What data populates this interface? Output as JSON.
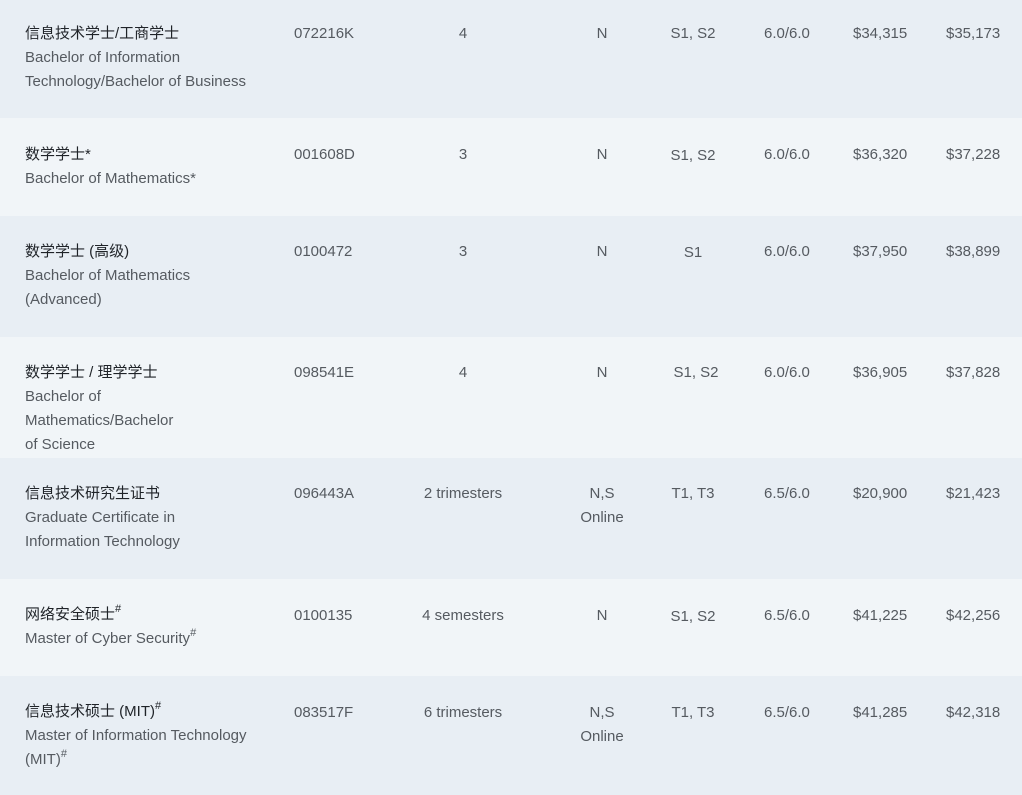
{
  "rows": [
    {
      "name_zh": "信息技术学士/工商学士",
      "name_en": "Bachelor of Information Technology/Bachelor of Business",
      "sup_zh": "",
      "sup_en": "",
      "code": "072216K",
      "duration": "4",
      "campus_line1": "N",
      "campus_line2": "",
      "intake": "S1, S2",
      "ielts": "6.0/6.0",
      "fee_a": "$34,315",
      "fee_b": "$35,173"
    },
    {
      "name_zh": "数学学士*",
      "name_en": "Bachelor of Mathematics*",
      "sup_zh": "",
      "sup_en": "",
      "code": "001608D",
      "duration": "3",
      "campus_line1": "N",
      "campus_line2": "",
      "intake": "S1, S2",
      "ielts": "6.0/6.0",
      "fee_a": "$36,320",
      "fee_b": "$37,228"
    },
    {
      "name_zh": "数学学士 (高级)",
      "name_en": "Bachelor of Mathematics (Advanced)",
      "sup_zh": "",
      "sup_en": "",
      "code": "0100472",
      "duration": "3",
      "campus_line1": "N",
      "campus_line2": "",
      "intake": "S1",
      "ielts": "6.0/6.0",
      "fee_a": "$37,950",
      "fee_b": "$38,899"
    },
    {
      "name_zh": "数学学士 / 理学学士",
      "name_en": "Bachelor of Mathematics/Bachelor of Science",
      "sup_zh": "",
      "sup_en": "",
      "code": "098541E",
      "duration": "4",
      "campus_line1": "N",
      "campus_line2": "",
      "intake": "S1, S2",
      "ielts": "6.0/6.0",
      "fee_a": "$36,905",
      "fee_b": "$37,828"
    },
    {
      "name_zh": "信息技术研究生证书",
      "name_en": "Graduate Certificate in Information Technology",
      "sup_zh": "",
      "sup_en": "",
      "code": "096443A",
      "duration": "2 trimesters",
      "campus_line1": "N,S",
      "campus_line2": "Online",
      "intake": "T1, T3",
      "ielts": "6.5/6.0",
      "fee_a": "$20,900",
      "fee_b": "$21,423"
    },
    {
      "name_zh": "网络安全硕士",
      "name_en": "Master of Cyber Security",
      "sup_zh": "#",
      "sup_en": "#",
      "code": "0100135",
      "duration": "4 semesters",
      "campus_line1": "N",
      "campus_line2": "",
      "intake": "S1, S2",
      "ielts": "6.5/6.0",
      "fee_a": "$41,225",
      "fee_b": "$42,256"
    },
    {
      "name_zh": "信息技术硕士 (MIT)",
      "name_en": "Master of Information Technology (MIT)",
      "sup_zh": "#",
      "sup_en": "#",
      "code": "083517F",
      "duration": "6 trimesters",
      "campus_line1": "N,S",
      "campus_line2": "Online",
      "intake": "T1, T3",
      "ielts": "6.5/6.0",
      "fee_a": "$41,285",
      "fee_b": "$42,318"
    }
  ]
}
